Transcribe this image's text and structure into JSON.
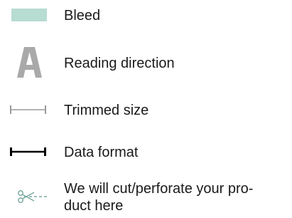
{
  "legend": {
    "items": [
      {
        "icon": "bleed-swatch-icon",
        "label": "Bleed",
        "color": "#b7dcd2"
      },
      {
        "icon": "letter-a-icon",
        "label": "Reading direction",
        "color": "#a9a9a9"
      },
      {
        "icon": "trimmed-size-line-icon",
        "label": "Trimmed size",
        "color": "#9a9a9a"
      },
      {
        "icon": "data-format-line-icon",
        "label": "Data format",
        "color": "#000000"
      },
      {
        "icon": "scissors-dashed-line-icon",
        "label": "We will cut/perforate your pro-\nduct here",
        "color": "#7aa9a0"
      }
    ]
  }
}
